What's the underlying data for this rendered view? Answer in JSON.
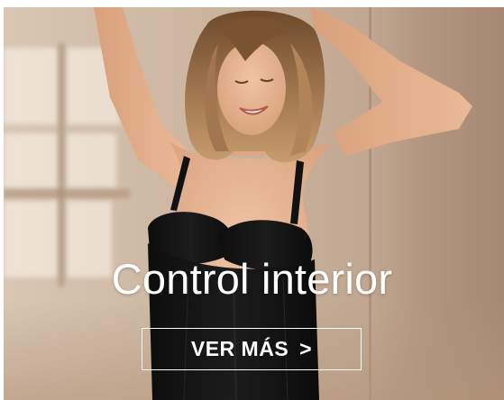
{
  "banner": {
    "title": "Control interior",
    "cta_label": "VER MÁS",
    "cta_arrow": ">",
    "image_description_icon": "model-photo"
  },
  "colors": {
    "text": "#ffffff",
    "wall": "#cdb7a2",
    "garment": "#141414",
    "skin": "#e6b796",
    "hair": "#8a6240"
  }
}
